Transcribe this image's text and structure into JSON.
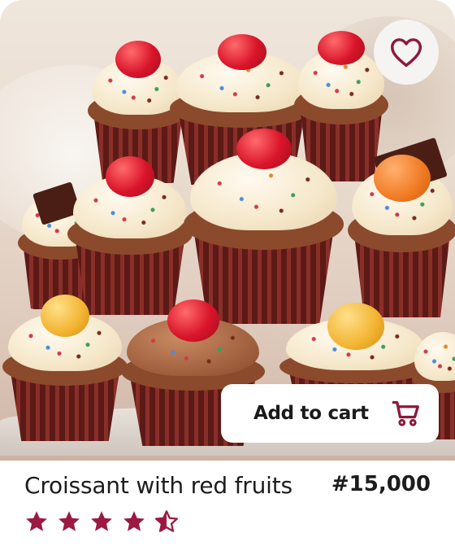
{
  "product": {
    "name": "Croissant with red fruits",
    "price": "#15,000",
    "rating": 4.5,
    "rating_max": 5
  },
  "actions": {
    "add_to_cart_label": "Add to cart",
    "favorite_icon": "heart-outline-icon",
    "cart_icon": "shopping-cart-icon"
  },
  "colors": {
    "accent": "#8b1a3a",
    "button_bg": "#ffffff",
    "fav_bg": "#f6f3f3",
    "text": "#1c1c1c"
  }
}
